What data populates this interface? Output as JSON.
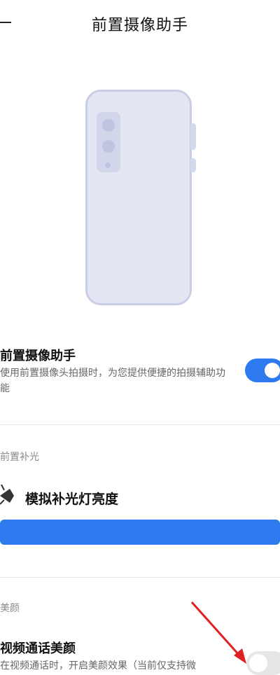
{
  "header": {
    "title": "前置摄像助手"
  },
  "assistant": {
    "title": "前置摄像助手",
    "description": "使用前置摄像头拍摄时，为您提供便捷的拍摄辅助功能",
    "enabled": true
  },
  "fill_light": {
    "section_label": "前置补光",
    "title": "模拟补光灯亮度",
    "level": 1.0
  },
  "beauty": {
    "section_label": "美颜",
    "title": "视频通话美颜",
    "description": "在视频通话时，开启美颜效果（当前仅支持微",
    "enabled": false
  },
  "colors": {
    "accent": "#2e7bf0",
    "annotation_arrow": "#e02020"
  },
  "icons": [
    "back-icon",
    "sparkle-icon"
  ]
}
